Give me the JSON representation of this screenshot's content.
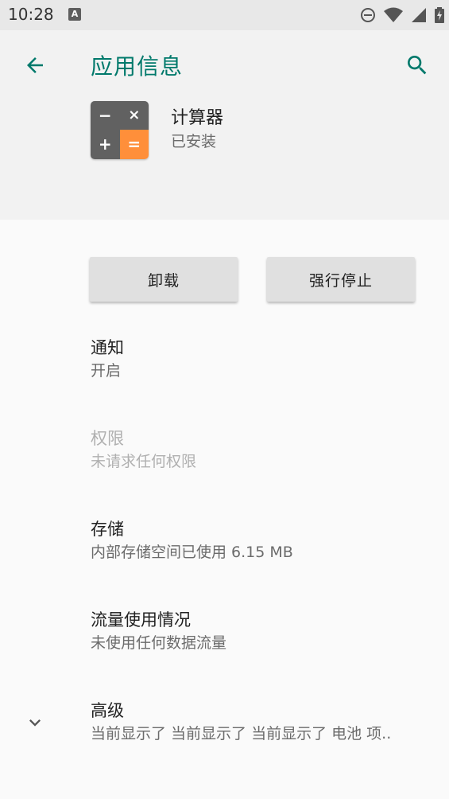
{
  "status_bar": {
    "time": "10:28",
    "notification_icon": "A"
  },
  "app_bar": {
    "title": "应用信息"
  },
  "app": {
    "name": "计算器",
    "status": "已安装",
    "icon_glyphs": [
      "−",
      "×",
      "+",
      "="
    ]
  },
  "buttons": {
    "uninstall": "卸载",
    "force_stop": "强行停止"
  },
  "settings": [
    {
      "title": "通知",
      "summary": "开启",
      "enabled": true
    },
    {
      "title": "权限",
      "summary": "未请求任何权限",
      "enabled": false
    },
    {
      "title": "存储",
      "summary": "内部存储空间已使用 6.15 MB",
      "enabled": true
    },
    {
      "title": "流量使用情况",
      "summary": "未使用任何数据流量",
      "enabled": true
    },
    {
      "title": "高级",
      "summary": "当前显示了 当前显示了 当前显示了 电池 项..",
      "enabled": true
    }
  ],
  "colors": {
    "accent": "#00796b",
    "calc_dark": "#616161",
    "calc_orange": "#ff8f3a"
  }
}
